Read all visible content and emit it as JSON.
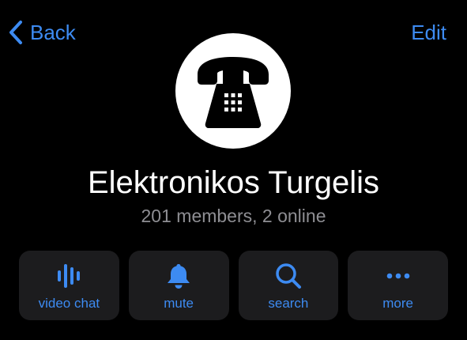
{
  "nav": {
    "back_label": "Back",
    "back_icon": "chevron-left-icon",
    "edit_label": "Edit"
  },
  "profile": {
    "avatar_icon": "telephone-icon",
    "name": "Elektronikos Turgelis",
    "status": "201 members, 2 online"
  },
  "actions": [
    {
      "label": "video chat",
      "icon": "voice-chat-icon"
    },
    {
      "label": "mute",
      "icon": "bell-icon"
    },
    {
      "label": "search",
      "icon": "search-icon"
    },
    {
      "label": "more",
      "icon": "more-dots-icon"
    }
  ],
  "colors": {
    "background": "#000000",
    "accent": "#3d8bf2",
    "secondary_text": "#8e8e93",
    "button_background": "#1c1c1e",
    "avatar_background": "#ffffff"
  }
}
